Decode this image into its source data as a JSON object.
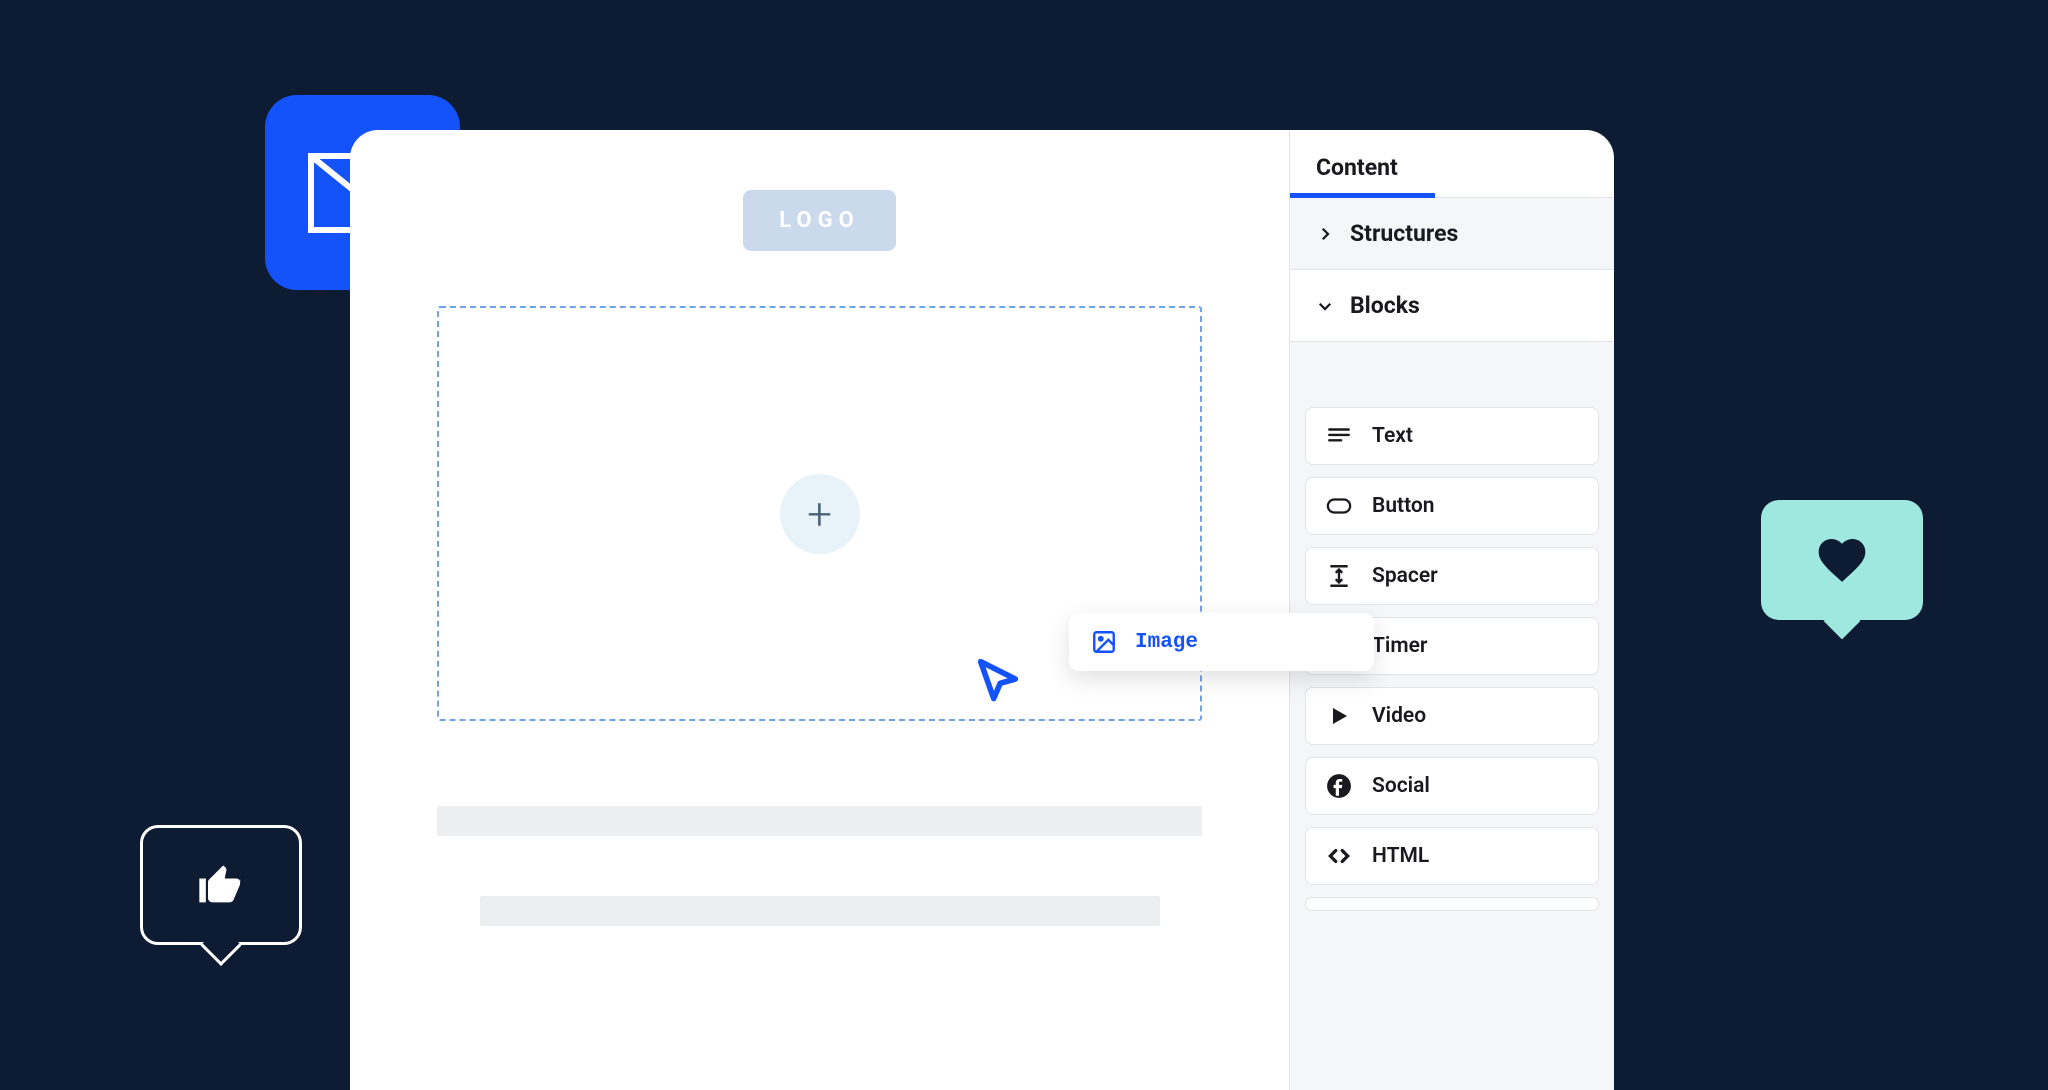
{
  "canvas": {
    "logo_label": "LOGO",
    "add_symbol": "+"
  },
  "sidebar": {
    "tab_label": "Content",
    "sections": {
      "structures": "Structures",
      "blocks": "Blocks"
    },
    "blocks": [
      {
        "name": "Text"
      },
      {
        "name": "Button"
      },
      {
        "name": "Spacer"
      },
      {
        "name": "Timer"
      },
      {
        "name": "Video"
      },
      {
        "name": "Social"
      },
      {
        "name": "HTML"
      }
    ]
  },
  "drag": {
    "label": "Image"
  },
  "colors": {
    "accent": "#1553fa",
    "bg": "#0d1b33",
    "mint": "#9fe8e0"
  }
}
